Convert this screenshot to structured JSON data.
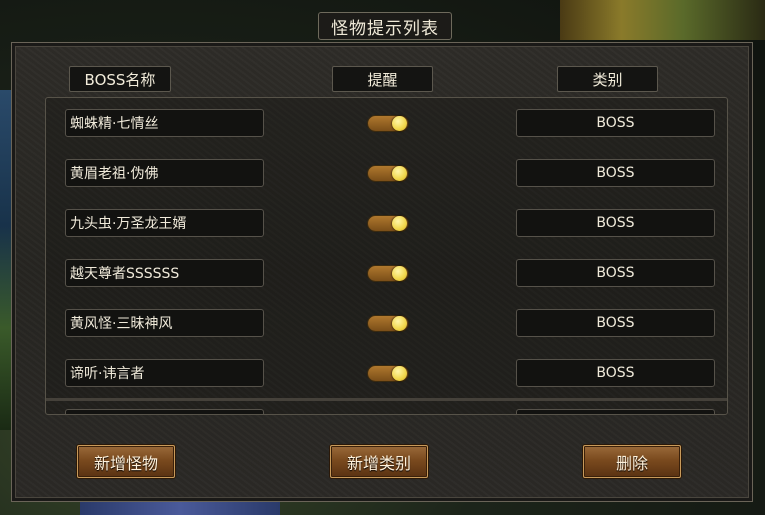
{
  "window": {
    "title": "怪物提示列表"
  },
  "headers": {
    "name": "BOSS名称",
    "alert": "提醒",
    "category": "类别"
  },
  "rows": [
    {
      "name": "蜘蛛精·七情丝",
      "alert_on": true,
      "category": "BOSS"
    },
    {
      "name": "黄眉老祖·伪佛",
      "alert_on": true,
      "category": "BOSS"
    },
    {
      "name": "九头虫·万圣龙王婿",
      "alert_on": true,
      "category": "BOSS"
    },
    {
      "name": "越天尊者SSSSSS",
      "alert_on": true,
      "category": "BOSS"
    },
    {
      "name": "黄风怪·三昧神风",
      "alert_on": true,
      "category": "BOSS"
    },
    {
      "name": "谛听·讳言者",
      "alert_on": true,
      "category": "BOSS"
    }
  ],
  "buttons": {
    "add_monster": "新增怪物",
    "add_category": "新增类别",
    "delete": "删除"
  },
  "colors": {
    "toggle_on": "#a8702a",
    "toggle_knob": "#f5e060",
    "button_brown": "#7a4a1e"
  }
}
